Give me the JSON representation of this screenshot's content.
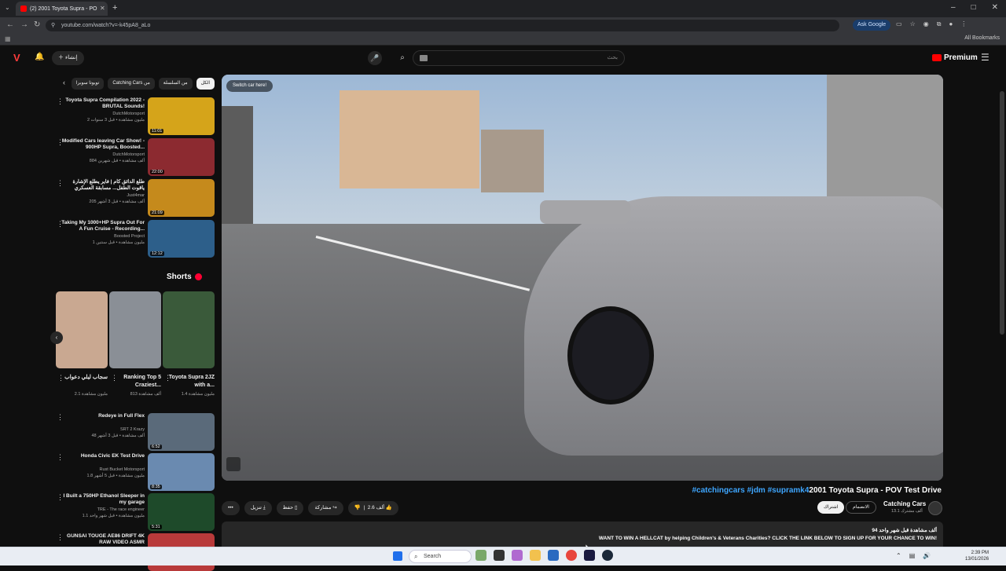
{
  "browser": {
    "tab_title": "(2) 2001 Toyota Supra - PO",
    "url": "youtube.com/watch?v=-k45pA8_aLo",
    "ask_google": "Ask Google",
    "all_bookmarks": "All Bookmarks"
  },
  "masthead": {
    "create_label": "إنشاء",
    "search_placeholder": "بحث",
    "premium_label": "Premium"
  },
  "chips": [
    "الكل",
    "من السلسلة",
    "Catching Cars من",
    "تويوتا سوبرا"
  ],
  "recommendations_top": [
    {
      "title": "Toyota Supra Compilation 2022 - BRUTAL Sounds!",
      "channel": "DutchMotorsport",
      "meta": "2 مليون مشاهدة • قبل 3 سنوات",
      "duration": "11:01",
      "thumb_color": "#d5a41a"
    },
    {
      "title": "Modified Cars leaving Car Show! - 900HP Supra, Boosted...",
      "channel": "DutchMotorsport",
      "meta": "884 ألف مشاهدة • قبل شهرين",
      "duration": "22:00",
      "thumb_color": "#8c2a30"
    },
    {
      "title": "طلع الدائق كام | فاير يطلع الإشارة ياقوت الطفل... مسابقة العسكري",
      "channel": "Just4mar",
      "meta": "205 ألف مشاهدة • قبل 3 أشهر",
      "duration": "21:09",
      "thumb_color": "#c58a1c"
    },
    {
      "title": "Taking My 1000+HP Supra Out For A Fun Cruise - Recording...",
      "channel": "Boosted Project",
      "meta": "1 مليون مشاهدة • قبل سنتين",
      "duration": "12:12",
      "thumb_color": "#2d5f8a"
    }
  ],
  "shorts": {
    "heading": "Shorts",
    "items": [
      {
        "title": "Toyota Supra 2JZ with a...",
        "views": "1.4 مليون مشاهدة",
        "thumb_color": "#3a5a3a"
      },
      {
        "title": "Ranking Top 5 Craziest...",
        "views": "813 ألف مشاهدة",
        "thumb_color": "#8a8f96"
      },
      {
        "title": "سجاب ليلي دعواب",
        "views": "2.1 مليون مشاهدة",
        "thumb_color": "#c9a891"
      }
    ]
  },
  "recommendations_bottom": [
    {
      "title": "Redeye in Full Flex",
      "channel": "SRT 2 Krazy",
      "meta": "48 ألف مشاهدة • قبل 3 أشهر",
      "duration": "6:52",
      "thumb_color": "#5a6a7a"
    },
    {
      "title": "Honda Civic EK Test Drive",
      "channel": "Rust Bucket Motorsport",
      "meta": "1.8 مليون مشاهدة • قبل 5 أشهر",
      "duration": "8:35",
      "thumb_color": "#6a8ab0"
    },
    {
      "title": "I Built a 750HP Ethanol Sleeper in my garage",
      "channel": "TRE - The race engineer",
      "meta": "1.1 مليون مشاهدة • قبل شهر واحد",
      "duration": "5:31",
      "thumb_color": "#1e4a2a"
    },
    {
      "title": "GUNSAI TOUGE AE86 DRIFT 4K RAW VIDEO ASMR",
      "channel": "",
      "meta": "",
      "duration": "",
      "thumb_color": "#b83a3a"
    }
  ],
  "player": {
    "switch_car": "Switch car here!"
  },
  "video": {
    "tags": "#catchingcars #jdm #supramk4",
    "title": "2001 Toyota Supra - POV Test Drive",
    "channel_name": "Catching Cars",
    "channel_subs": "13.1 ألف مشترك",
    "subscribe": "اشتراك",
    "join": "الانضمام",
    "likes": "2.6 ألف",
    "share": "مشاركة",
    "save": "حفظ",
    "download": "تنزيل",
    "more": "•••",
    "desc_stats": "94 ألف مشاهدة قبل شهر واحد",
    "desc_text": "WANT TO WIN A HELLCAT by helping Children's & Veterans Charities? CLICK THE LINK BELOW TO SIGN UP FOR YOUR CHANCE TO WIN!"
  },
  "taskbar": {
    "search": "Search",
    "time": "2:39 PM",
    "date": "13/01/2026"
  }
}
